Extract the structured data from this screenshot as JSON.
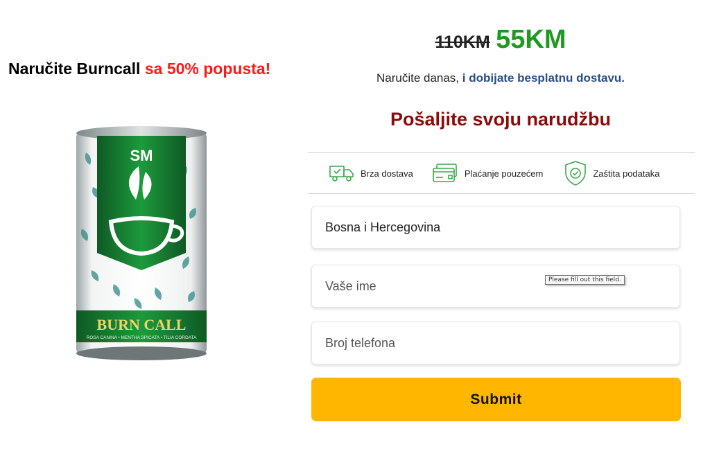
{
  "promo": {
    "headline_prefix": "Naručite Burncall",
    "headline_highlight": "sa 50% popusta!"
  },
  "product": {
    "image_icon": "product-can-icon",
    "logo_text": "SM",
    "can_name": "BURN CALL",
    "ingredients": "ROSA CANINA • MENTHA SPICATA • TILIA CORDATA"
  },
  "price": {
    "old": "110KM",
    "new": "55KM"
  },
  "delivery_note": {
    "prefix": "Naručite danas,",
    "highlight": "i dobijate besplatnu dostavu."
  },
  "form": {
    "title": "Pošaljite svoju narudžbu",
    "features": [
      {
        "icon": "delivery-truck-icon",
        "label": "Brza dostava"
      },
      {
        "icon": "credit-card-icon",
        "label": "Plaćanje pouzećem"
      },
      {
        "icon": "shield-check-icon",
        "label": "Zaštita podataka"
      }
    ],
    "country_value": "Bosna i Hercegovina",
    "name_placeholder": "Vaše ime",
    "phone_placeholder": "Broj telefona",
    "validation_tooltip": "Please fill out this field.",
    "submit_label": "Submit"
  },
  "colors": {
    "accent_red": "#ff1a1a",
    "new_price_green": "#1f9a1f",
    "title_dark_red": "#8b0b0b",
    "submit_yellow": "#ffb600",
    "icon_green": "#3aa84a"
  }
}
